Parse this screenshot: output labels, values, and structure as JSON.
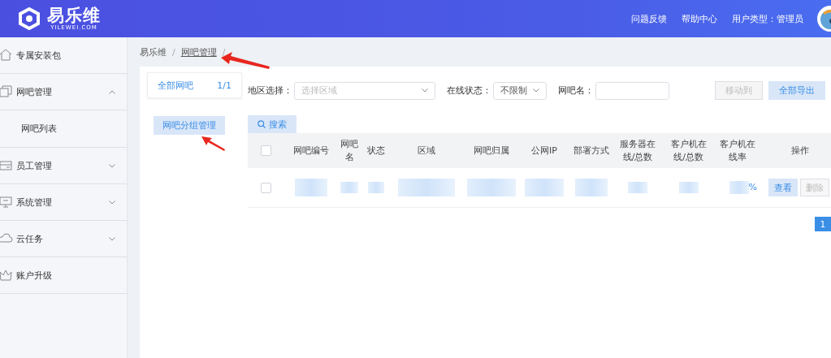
{
  "header": {
    "logo_text": "易乐维",
    "logo_subtext": "YILEWEI.COM",
    "links": [
      "问题反馈",
      "帮助中心",
      "用户类型：管理员"
    ]
  },
  "sidebar": {
    "items": [
      {
        "label": "专属安装包",
        "kind": "plain"
      },
      {
        "label": "网吧管理",
        "kind": "group",
        "expanded": true,
        "children": [
          {
            "label": "网吧列表"
          }
        ]
      },
      {
        "label": "员工管理",
        "kind": "group",
        "expanded": false
      },
      {
        "label": "系统管理",
        "kind": "group",
        "expanded": false
      },
      {
        "label": "云任务",
        "kind": "group",
        "expanded": false
      },
      {
        "label": "账户升级",
        "kind": "plain"
      }
    ]
  },
  "breadcrumb": {
    "items": [
      "易乐维",
      "网吧管理"
    ],
    "separator": "/"
  },
  "group_panel": {
    "all_label": "全部网吧",
    "all_count": "1/1",
    "manage_button": "网吧分组管理"
  },
  "filters": [
    {
      "kind": "select",
      "label": "地区选择：",
      "placeholder": "选择区域"
    },
    {
      "kind": "select",
      "label": "在线状态：",
      "value": "不限制"
    },
    {
      "kind": "text",
      "label": "网吧名："
    }
  ],
  "actions": [
    {
      "label": "移动到",
      "disabled": true
    },
    {
      "label": "全部导出",
      "disabled": false
    }
  ],
  "search_button": "搜索",
  "table": {
    "header_checked": false,
    "columns": [
      "网吧编号",
      "网吧名",
      "状态",
      "区域",
      "网吧归属",
      "公网IP",
      "部署方式",
      "服务器在线/总数",
      "客户机在线/总数",
      "客户机在线率",
      "操作"
    ],
    "rows": [
      {
        "checked": false,
        "rate_suffix": "%",
        "buttons": [
          {
            "label": "查看",
            "disabled": false
          },
          {
            "label": "删除",
            "disabled": true
          }
        ]
      }
    ]
  },
  "pagination": [
    {
      "label": "1",
      "selected": true
    }
  ]
}
